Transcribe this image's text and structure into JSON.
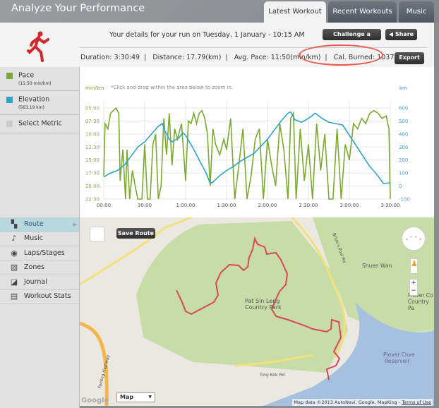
{
  "header": {
    "title": "Analyze Your Performance",
    "tabs": [
      {
        "label": "Latest Workout",
        "active": true
      },
      {
        "label": "Recent Workouts"
      },
      {
        "label": "Music"
      }
    ]
  },
  "summary": {
    "details": "Your details for your run on Tuesday, 1 January - 10:15 AM",
    "challenge_label": "Challenge a Friend",
    "share_label": "Share",
    "export_label": "Export",
    "duration": "Duration: 3:30:49",
    "distance": "Distance: 17.79(km)",
    "avg_pace": "Avg. Pace: 11:50(min/km)",
    "calories": "Cal. Burned: 1037",
    "highlight_color": "#e8584f"
  },
  "metrics": [
    {
      "name": "Pace",
      "value": "(11:50 min/km)",
      "color": "#7aaa2e"
    },
    {
      "name": "Elevation",
      "value": "(563.19 km)",
      "color": "#2ba3cf"
    },
    {
      "name": "Select Metric",
      "value": "",
      "color": "#cccccc"
    }
  ],
  "nav": [
    {
      "label": "Route",
      "icon": "route-map-icon",
      "active": true
    },
    {
      "label": "Music",
      "icon": "music-note-icon"
    },
    {
      "label": "Laps/Stages",
      "icon": "stopwatch-icon"
    },
    {
      "label": "Zones",
      "icon": "zones-icon"
    },
    {
      "label": "Journal",
      "icon": "journal-icon"
    },
    {
      "label": "Workout Stats",
      "icon": "stats-icon"
    }
  ],
  "chart_data": {
    "type": "line",
    "hint": "*Click and drag within the area below to zoom in.",
    "ylabel_left": "min/km",
    "ylabel_right": "km",
    "x_ticks": [
      "00:00",
      "30:00",
      "1:00:00",
      "1:30:00",
      "2:00:00",
      "2:30:00",
      "3:00:00",
      "3:30:00"
    ],
    "y_left_ticks": [
      "05:00",
      "07:30",
      "10:00",
      "12:30",
      "15:00",
      "17:30",
      "20:00",
      "22:30"
    ],
    "y_right_ticks": [
      "600",
      "500",
      "400",
      "300",
      "200",
      "100",
      "0",
      "-100"
    ],
    "xlim_minutes": [
      0,
      210
    ],
    "ylim_left_minutes": [
      5,
      22.5
    ],
    "ylim_right": [
      -100,
      600
    ],
    "grid": true,
    "series": [
      {
        "name": "Pace",
        "color": "#7aaa2e",
        "x_minutes": [
          0,
          1,
          3,
          5,
          7,
          9,
          11,
          12,
          14,
          16,
          17,
          19,
          21,
          23,
          25,
          28,
          30,
          32,
          34,
          36,
          38,
          40,
          42,
          44,
          46,
          48,
          50,
          52,
          54,
          57,
          60,
          62,
          64,
          66,
          68,
          70,
          72,
          74,
          76,
          78,
          80,
          82,
          85,
          88,
          90,
          93,
          96,
          99,
          102,
          105,
          108,
          111,
          114,
          117,
          120,
          123,
          126,
          129,
          132,
          135,
          137,
          139,
          141,
          144,
          147,
          150,
          153,
          156,
          159,
          162,
          165,
          168,
          171,
          174,
          177,
          180,
          183,
          186,
          189,
          192,
          195,
          198,
          201,
          204,
          207,
          209,
          210
        ],
        "values": [
          18,
          8,
          9,
          6,
          5.5,
          5,
          6,
          19,
          13,
          22.5,
          13,
          22.5,
          17,
          20,
          22.5,
          22.5,
          12,
          22.5,
          22.5,
          12,
          10,
          22.5,
          20,
          7,
          14,
          6,
          16,
          9,
          11,
          8,
          19,
          7.5,
          8,
          6,
          8,
          6,
          5.5,
          7,
          10,
          20,
          9,
          12,
          14,
          11,
          13,
          7,
          22.5,
          16,
          9,
          22.5,
          18,
          11,
          9,
          22.5,
          11,
          16,
          20,
          8,
          13,
          22.5,
          7,
          6,
          22.5,
          9,
          19,
          12,
          22.5,
          8,
          17,
          10,
          22.5,
          22.5,
          9,
          22.5,
          12,
          15,
          8,
          9,
          7,
          8,
          6,
          5.5,
          6,
          7,
          6.5,
          9,
          22.5
        ]
      },
      {
        "name": "Elevation",
        "color": "#2ba3cf",
        "x_minutes": [
          0,
          5,
          10,
          15,
          20,
          25,
          30,
          35,
          40,
          43,
          45,
          48,
          50,
          55,
          58,
          60,
          65,
          70,
          75,
          78,
          80,
          85,
          90,
          95,
          100,
          110,
          120,
          125,
          130,
          135,
          137,
          140,
          145,
          150,
          155,
          160,
          165,
          170,
          175,
          180,
          185,
          190,
          195,
          200,
          205,
          210
        ],
        "values": [
          70,
          100,
          120,
          160,
          230,
          300,
          340,
          400,
          460,
          480,
          420,
          360,
          340,
          370,
          410,
          390,
          300,
          200,
          100,
          20,
          30,
          80,
          120,
          150,
          190,
          250,
          360,
          430,
          500,
          560,
          570,
          510,
          490,
          520,
          560,
          520,
          490,
          480,
          470,
          390,
          310,
          230,
          150,
          90,
          20,
          25
        ]
      }
    ]
  },
  "map": {
    "save_label": "Save Route",
    "type_label": "Map",
    "attribution": "Map data ©2013 AutoNavi, Google, MapKing -",
    "terms": "Terms of Use",
    "logo": "Google",
    "labels": [
      "Pat Sin Leng",
      "Country Park",
      "Shuen Wan",
      "Plover Cove",
      "Reservoir",
      "Plover Co",
      "Country Pa",
      "Ting Kok Rd",
      "Bride's Pool Rd",
      "Fanling Highway",
      "Plover Cove"
    ],
    "route_color": "#d9475a",
    "park_color": "#c7dca6",
    "water_color": "#a6c1e0"
  }
}
